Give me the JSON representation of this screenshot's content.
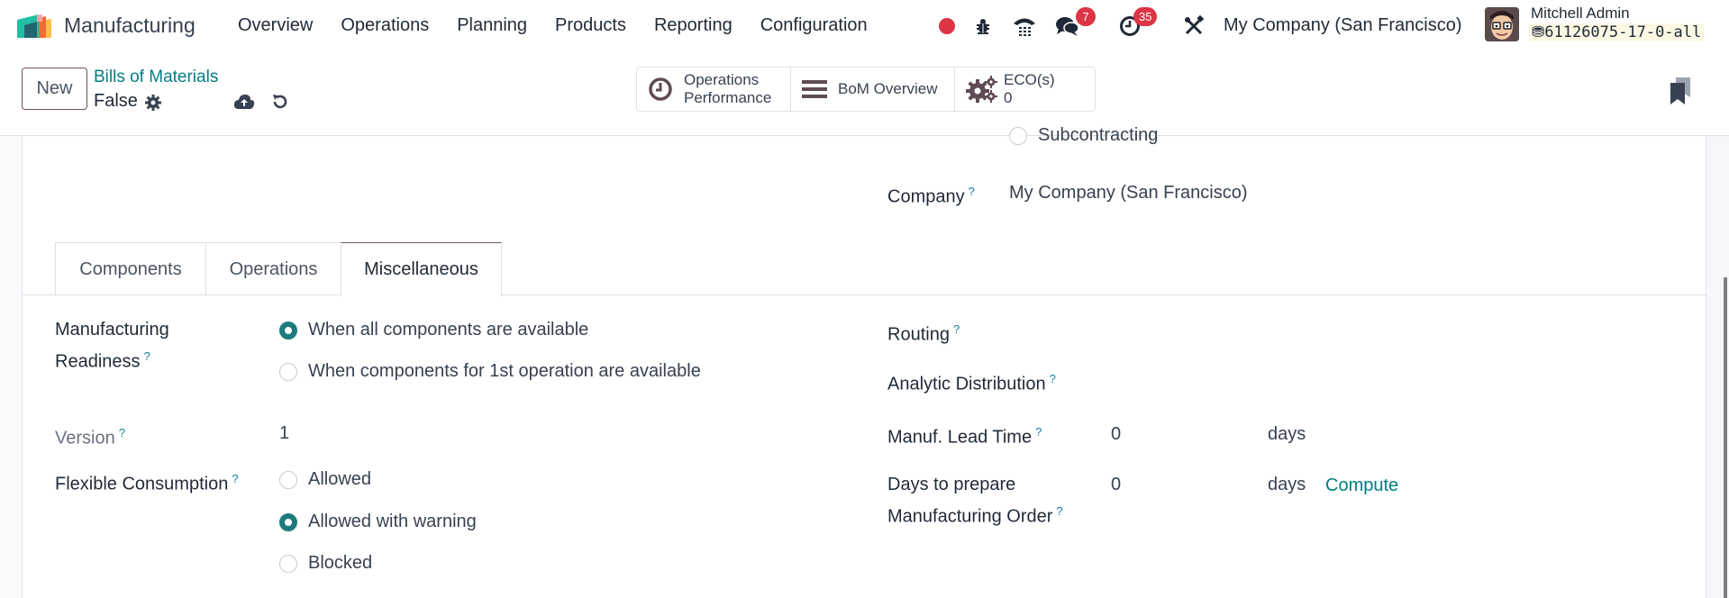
{
  "navbar": {
    "app_name": "Manufacturing",
    "menu": [
      "Overview",
      "Operations",
      "Planning",
      "Products",
      "Reporting",
      "Configuration"
    ],
    "systray": {
      "recording_icon": "record-dot",
      "debug_icon": "bug-icon",
      "phone_icon": "phone-icon",
      "messages_icon": "chat-icon",
      "messages_count": "7",
      "activities_icon": "clock-icon",
      "activities_count": "35",
      "tools_icon": "tools-icon"
    },
    "company": "My Company (San Francisco)",
    "user_name": "Mitchell Admin",
    "database": "61126075-17-0-all"
  },
  "control_panel": {
    "new_label": "New",
    "breadcrumb": "Bills of Materials",
    "record_name": "False",
    "smart_buttons": [
      {
        "icon": "clock-icon",
        "line1": "Operations",
        "line2": "Performance"
      },
      {
        "icon": "bars-icon",
        "line1": "BoM Overview",
        "line2": ""
      },
      {
        "icon": "cogs-icon",
        "line1": "ECO(s)",
        "line2": "0"
      }
    ]
  },
  "form": {
    "top": {
      "subcontracting_label": "Subcontracting",
      "company_label": "Company",
      "company_value": "My Company (San Francisco)"
    },
    "tabs": [
      {
        "label": "Components",
        "active": false
      },
      {
        "label": "Operations",
        "active": false
      },
      {
        "label": "Miscellaneous",
        "active": true
      }
    ],
    "misc": {
      "readiness_label_1": "Manufacturing",
      "readiness_label_2": "Readiness",
      "readiness_options": [
        {
          "label": "When all components are available",
          "checked": true
        },
        {
          "label": "When components for 1st operation are available",
          "checked": false
        }
      ],
      "version_label": "Version",
      "version_value": "1",
      "flex_label": "Flexible Consumption",
      "flex_options": [
        {
          "label": "Allowed",
          "checked": false
        },
        {
          "label": "Allowed with warning",
          "checked": true
        },
        {
          "label": "Blocked",
          "checked": false
        }
      ],
      "routing_label": "Routing",
      "analytic_label": "Analytic Distribution",
      "lead_time_label": "Manuf. Lead Time",
      "lead_time_value": "0",
      "lead_time_unit": "days",
      "prepare_label_1": "Days to prepare",
      "prepare_label_2": "Manufacturing Order",
      "prepare_value": "0",
      "prepare_unit": "days",
      "compute_label": "Compute"
    },
    "help_mark": "?"
  },
  "colors": {
    "primary": "#71525f",
    "link": "#017e84",
    "radio_checked": "#1f7a7f",
    "badge": "#dc3545"
  }
}
